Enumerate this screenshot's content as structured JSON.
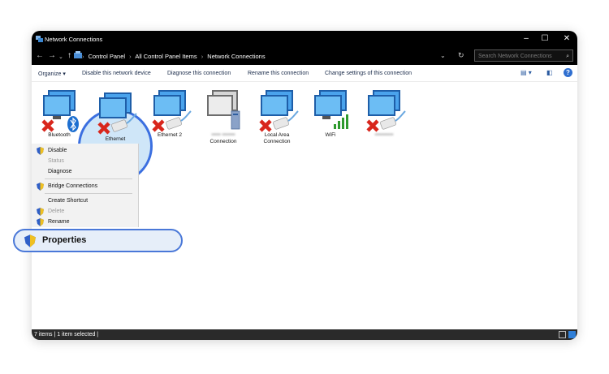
{
  "window": {
    "title": "Network Connections"
  },
  "address": {
    "crumbs": [
      "Control Panel",
      "All Control Panel Items",
      "Network Connections"
    ],
    "search_placeholder": "Search Network Connections"
  },
  "toolbar": {
    "organize": "Organize ▾",
    "disable": "Disable this network device",
    "diagnose": "Diagnose this connection",
    "rename": "Rename this connection",
    "change": "Change settings of this connection"
  },
  "adapters": [
    {
      "label": "Bluetooth",
      "type": "bluetooth",
      "status": "disconnected"
    },
    {
      "label": "Ethernet",
      "type": "ethernet",
      "status": "disconnected",
      "selected": true
    },
    {
      "label": "Ethernet 2",
      "type": "ethernet",
      "status": "disconnected"
    },
    {
      "label": "Connection",
      "type": "generic",
      "status": "connected",
      "blurred_name": true
    },
    {
      "label": "Local Area Connection",
      "type": "ethernet",
      "status": "disconnected"
    },
    {
      "label": "WiFi",
      "type": "wifi",
      "status": "connected"
    },
    {
      "label": "",
      "type": "ethernet",
      "status": "disconnected",
      "blurred_name": true
    }
  ],
  "context_menu": {
    "disable": "Disable",
    "status": "Status",
    "diagnose": "Diagnose",
    "bridge": "Bridge Connections",
    "shortcut": "Create Shortcut",
    "delete": "Delete",
    "rename": "Rename",
    "properties": "Properties"
  },
  "status": {
    "text": "7 items  |  1 item selected  |"
  },
  "colors": {
    "accent": "#3b6fe0",
    "titlebar": "#000000",
    "highlight": "#cfe6f8"
  }
}
